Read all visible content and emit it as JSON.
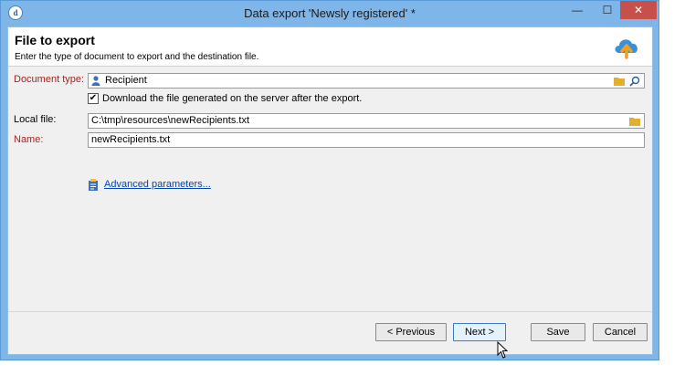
{
  "window": {
    "title": "Data export 'Newsly registered' *",
    "app_icon_letter": "d",
    "minimize_glyph": "—",
    "maximize_glyph": "☐",
    "close_glyph": "✕"
  },
  "header": {
    "title": "File to export",
    "subtitle": "Enter the type of document to export and the destination file."
  },
  "form": {
    "document_type": {
      "label": "Document type:",
      "value": "Recipient"
    },
    "download_checkbox": {
      "checked_glyph": "✔",
      "label": "Download the file generated on the server after the export.",
      "checked": true
    },
    "local_file": {
      "label": "Local file:",
      "value": "C:\\tmp\\resources\\newRecipients.txt"
    },
    "name": {
      "label": "Name:",
      "value": "newRecipients.txt"
    },
    "advanced_link": "Advanced parameters..."
  },
  "buttons": {
    "previous": "< Previous",
    "next": "Next >",
    "save": "Save",
    "cancel": "Cancel"
  }
}
